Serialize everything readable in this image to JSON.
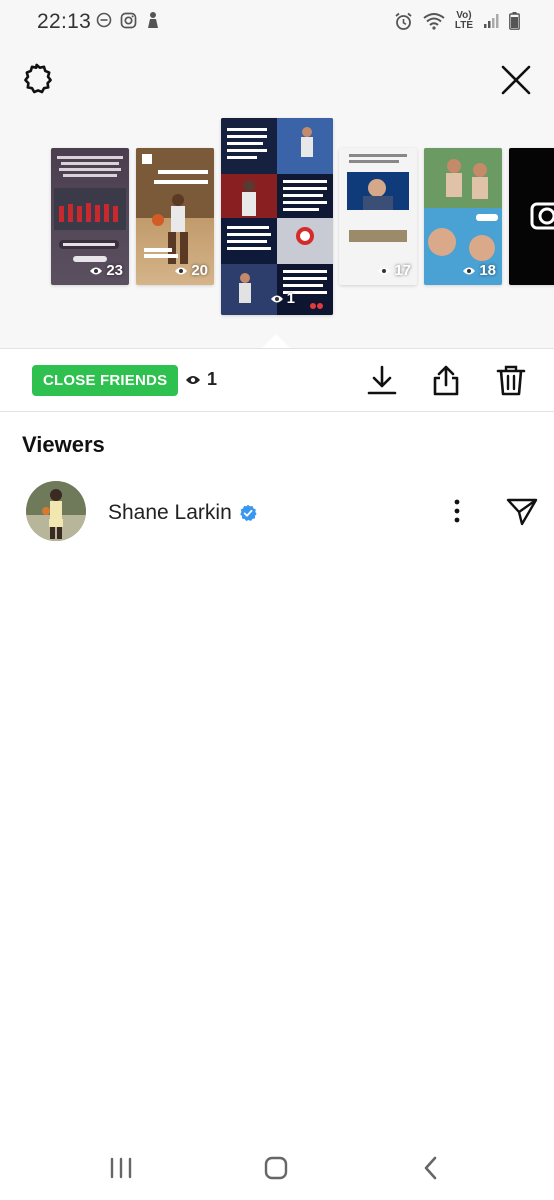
{
  "status_bar": {
    "time": "22:13",
    "left_icons": [
      "dnd-icon",
      "instagram-icon",
      "notification-icon"
    ],
    "network_line1": "Vo)",
    "network_line2": "LTE",
    "right_icons": [
      "alarm-icon",
      "wifi-icon",
      "signal-icon",
      "battery-icon"
    ]
  },
  "header": {
    "settings_icon": "settings-gear-icon",
    "close_icon": "close-icon"
  },
  "stories": [
    {
      "views": "23",
      "bg": "#4b3f4f",
      "selected": false
    },
    {
      "views": "20",
      "bg": "#b48a5c",
      "selected": false
    },
    {
      "views": "1",
      "bg": "#1f2b55",
      "selected": true
    },
    {
      "views": "17",
      "bg": "#f4f4f4",
      "selected": false
    },
    {
      "views": "18",
      "bg": "#3b90c8",
      "selected": false
    },
    {
      "views": "",
      "bg": "#050505",
      "selected": false
    }
  ],
  "action_bar": {
    "close_friends_label": "CLOSE FRIENDS",
    "close_friends_color": "#2fc150",
    "view_count": "1",
    "actions": [
      "download-icon",
      "share-icon",
      "delete-icon"
    ]
  },
  "viewers": {
    "title": "Viewers",
    "items": [
      {
        "name": "Shane Larkin",
        "verified": true,
        "verified_color": "#3897f0"
      }
    ]
  },
  "nav_bar": {
    "buttons": [
      "recent-apps-icon",
      "home-icon",
      "back-icon"
    ]
  }
}
